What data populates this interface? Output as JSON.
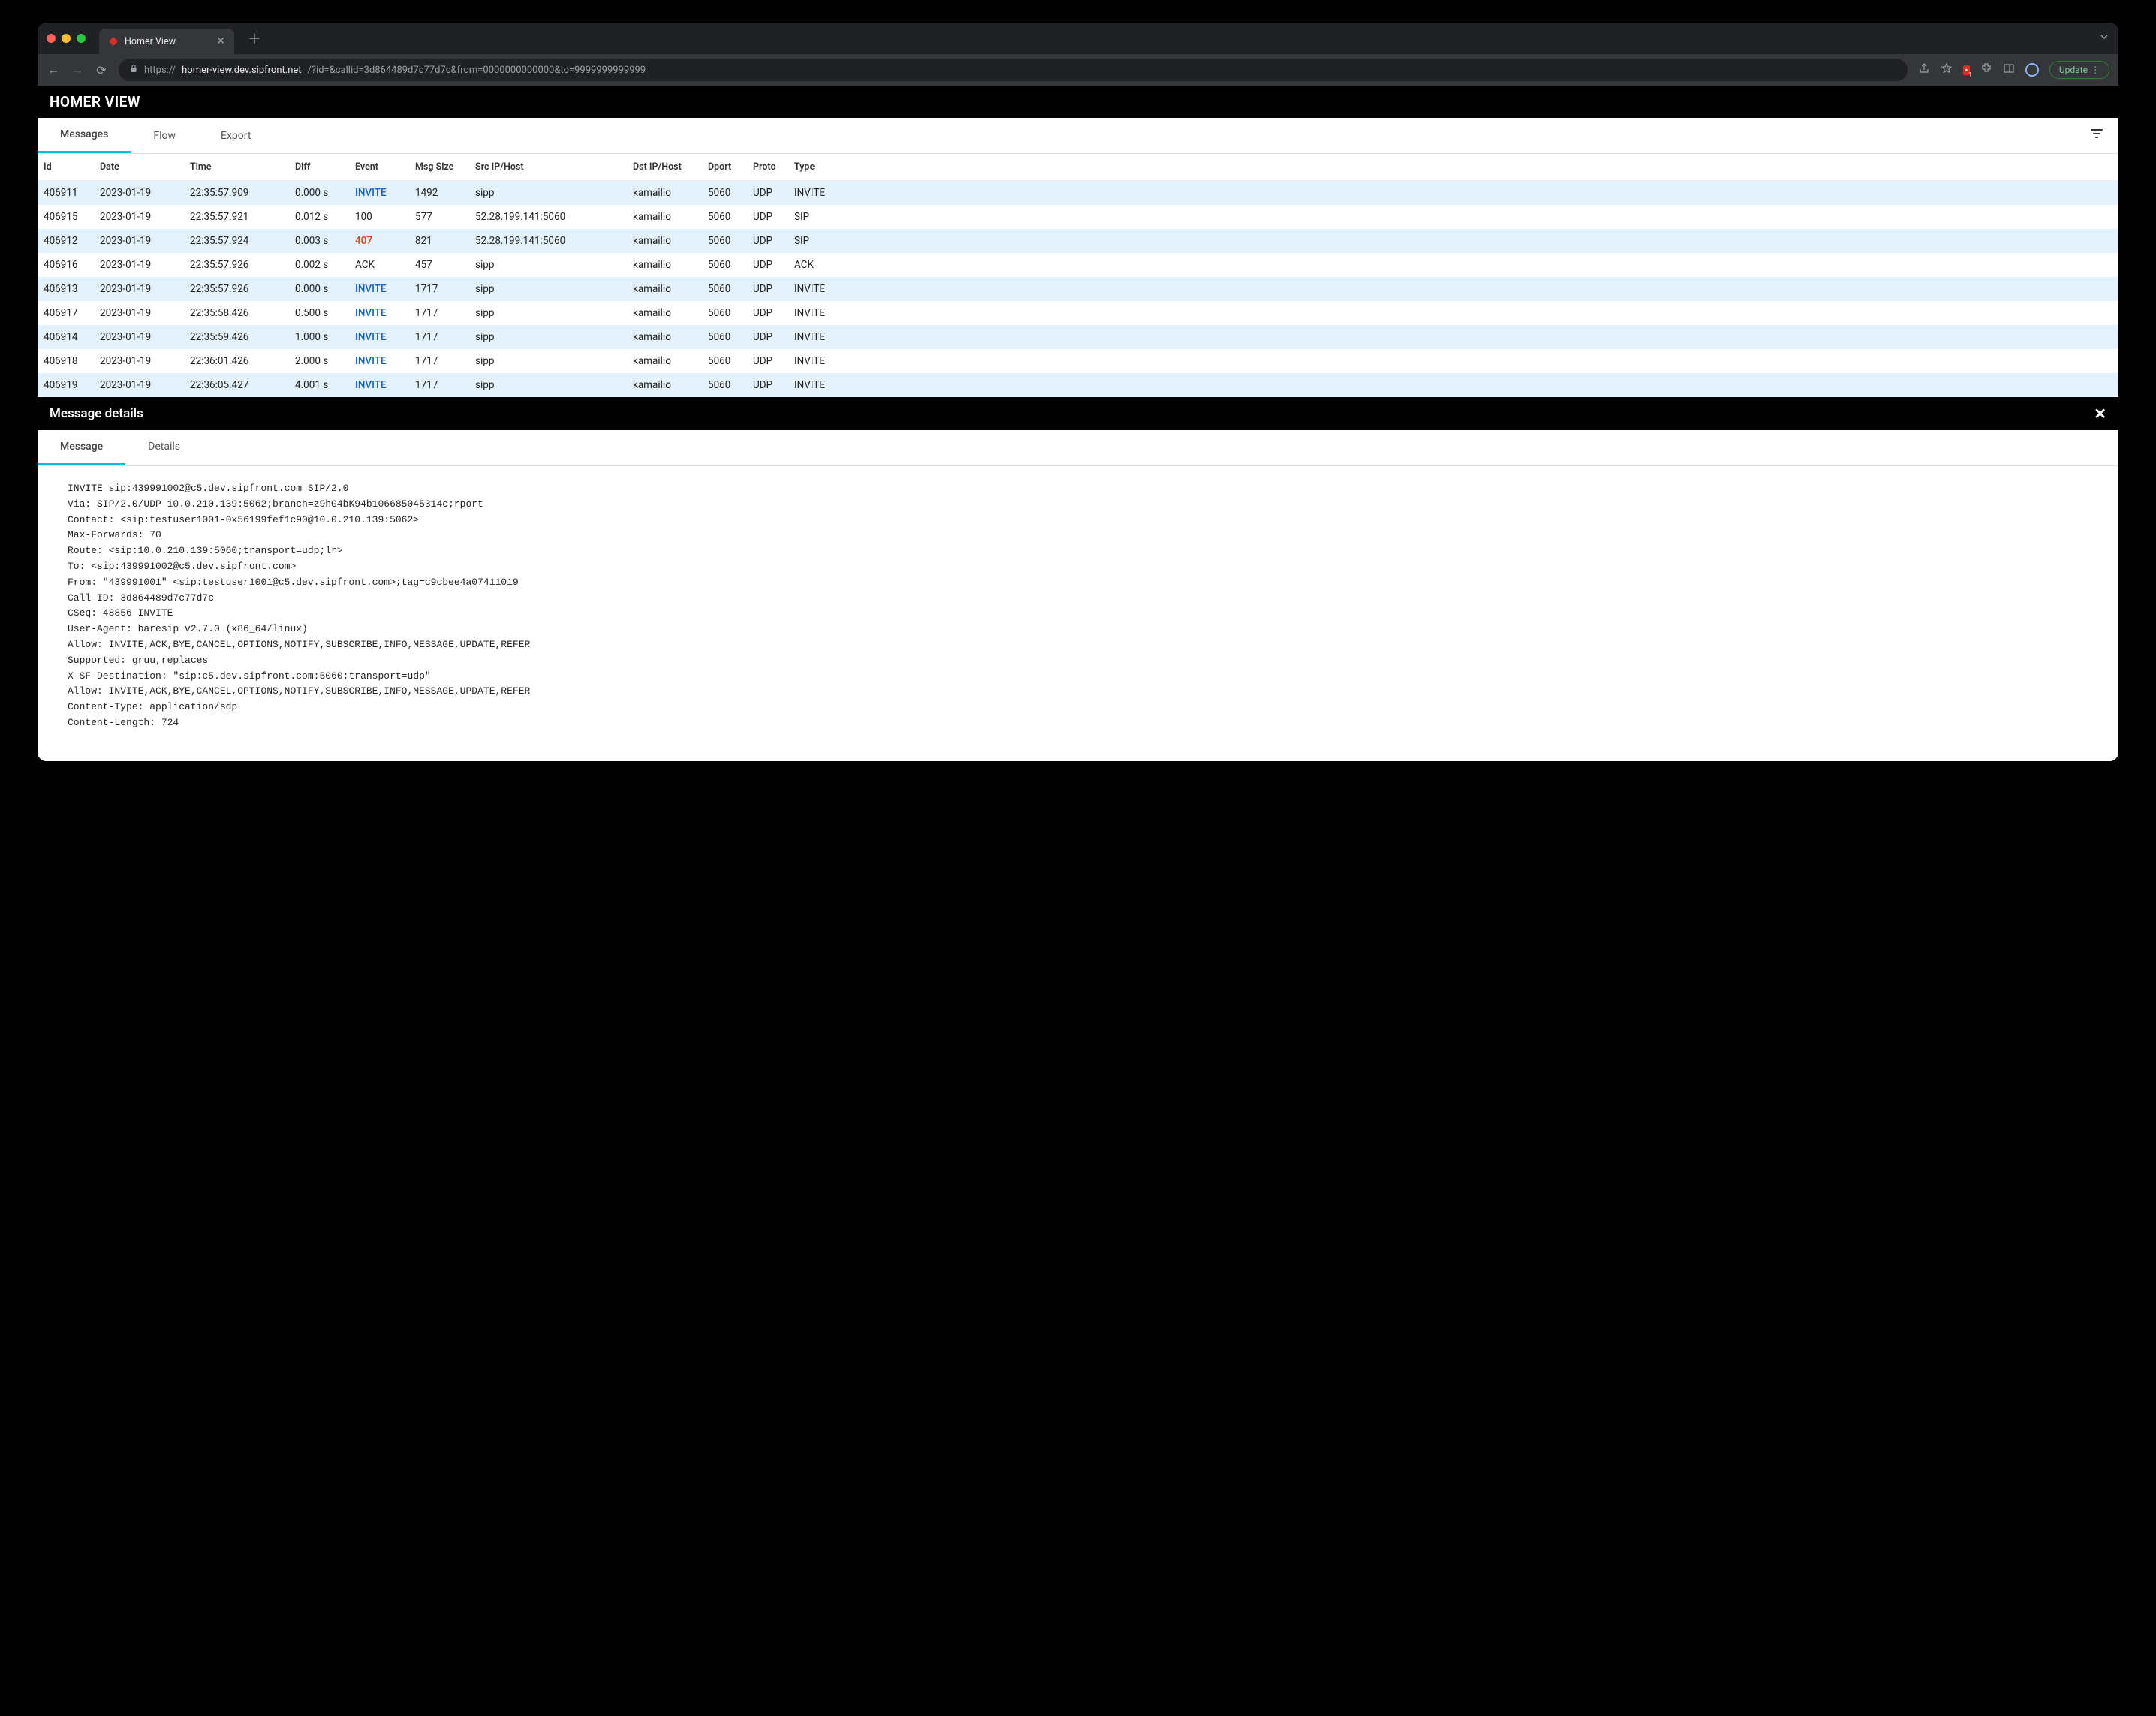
{
  "browser": {
    "tab_title": "Homer View",
    "url_scheme": "https://",
    "url_host": "homer-view.dev.sipfront.net",
    "url_path": "/?id=&callid=3d864489d7c77d7c&from=0000000000000&to=9999999999999",
    "update_label": "Update"
  },
  "header": {
    "title": "HOMER VIEW"
  },
  "tabs": {
    "messages": "Messages",
    "flow": "Flow",
    "export": "Export"
  },
  "columns": [
    "Id",
    "Date",
    "Time",
    "Diff",
    "Event",
    "Msg Size",
    "Src IP/Host",
    "Dst IP/Host",
    "Dport",
    "Proto",
    "Type"
  ],
  "rows": [
    {
      "id": "406911",
      "date": "2023-01-19",
      "time": "22:35:57.909",
      "diff": "0.000 s",
      "event": "INVITE",
      "ev_class": "ev-invite",
      "size": "1492",
      "src": "sipp",
      "dst": "kamailio",
      "dport": "5060",
      "proto": "UDP",
      "type": "INVITE"
    },
    {
      "id": "406915",
      "date": "2023-01-19",
      "time": "22:35:57.921",
      "diff": "0.012 s",
      "event": "100",
      "ev_class": "ev-plain",
      "size": "577",
      "src": "52.28.199.141:5060",
      "dst": "kamailio",
      "dport": "5060",
      "proto": "UDP",
      "type": "SIP"
    },
    {
      "id": "406912",
      "date": "2023-01-19",
      "time": "22:35:57.924",
      "diff": "0.003 s",
      "event": "407",
      "ev_class": "ev-407",
      "size": "821",
      "src": "52.28.199.141:5060",
      "dst": "kamailio",
      "dport": "5060",
      "proto": "UDP",
      "type": "SIP"
    },
    {
      "id": "406916",
      "date": "2023-01-19",
      "time": "22:35:57.926",
      "diff": "0.002 s",
      "event": "ACK",
      "ev_class": "ev-plain",
      "size": "457",
      "src": "sipp",
      "dst": "kamailio",
      "dport": "5060",
      "proto": "UDP",
      "type": "ACK"
    },
    {
      "id": "406913",
      "date": "2023-01-19",
      "time": "22:35:57.926",
      "diff": "0.000 s",
      "event": "INVITE",
      "ev_class": "ev-invite",
      "size": "1717",
      "src": "sipp",
      "dst": "kamailio",
      "dport": "5060",
      "proto": "UDP",
      "type": "INVITE"
    },
    {
      "id": "406917",
      "date": "2023-01-19",
      "time": "22:35:58.426",
      "diff": "0.500 s",
      "event": "INVITE",
      "ev_class": "ev-invite",
      "size": "1717",
      "src": "sipp",
      "dst": "kamailio",
      "dport": "5060",
      "proto": "UDP",
      "type": "INVITE"
    },
    {
      "id": "406914",
      "date": "2023-01-19",
      "time": "22:35:59.426",
      "diff": "1.000 s",
      "event": "INVITE",
      "ev_class": "ev-invite",
      "size": "1717",
      "src": "sipp",
      "dst": "kamailio",
      "dport": "5060",
      "proto": "UDP",
      "type": "INVITE"
    },
    {
      "id": "406918",
      "date": "2023-01-19",
      "time": "22:36:01.426",
      "diff": "2.000 s",
      "event": "INVITE",
      "ev_class": "ev-invite",
      "size": "1717",
      "src": "sipp",
      "dst": "kamailio",
      "dport": "5060",
      "proto": "UDP",
      "type": "INVITE"
    },
    {
      "id": "406919",
      "date": "2023-01-19",
      "time": "22:36:05.427",
      "diff": "4.001 s",
      "event": "INVITE",
      "ev_class": "ev-invite",
      "size": "1717",
      "src": "sipp",
      "dst": "kamailio",
      "dport": "5060",
      "proto": "UDP",
      "type": "INVITE"
    }
  ],
  "details": {
    "title": "Message details",
    "tabs": {
      "message": "Message",
      "details": "Details"
    },
    "body": "INVITE sip:439991002@c5.dev.sipfront.com SIP/2.0\nVia: SIP/2.0/UDP 10.0.210.139:5062;branch=z9hG4bK94b106685045314c;rport\nContact: <sip:testuser1001-0x56199fef1c90@10.0.210.139:5062>\nMax-Forwards: 70\nRoute: <sip:10.0.210.139:5060;transport=udp;lr>\nTo: <sip:439991002@c5.dev.sipfront.com>\nFrom: \"439991001\" <sip:testuser1001@c5.dev.sipfront.com>;tag=c9cbee4a07411019\nCall-ID: 3d864489d7c77d7c\nCSeq: 48856 INVITE\nUser-Agent: baresip v2.7.0 (x86_64/linux)\nAllow: INVITE,ACK,BYE,CANCEL,OPTIONS,NOTIFY,SUBSCRIBE,INFO,MESSAGE,UPDATE,REFER\nSupported: gruu,replaces\nX-SF-Destination: \"sip:c5.dev.sipfront.com:5060;transport=udp\"\nAllow: INVITE,ACK,BYE,CANCEL,OPTIONS,NOTIFY,SUBSCRIBE,INFO,MESSAGE,UPDATE,REFER\nContent-Type: application/sdp\nContent-Length: 724"
  }
}
